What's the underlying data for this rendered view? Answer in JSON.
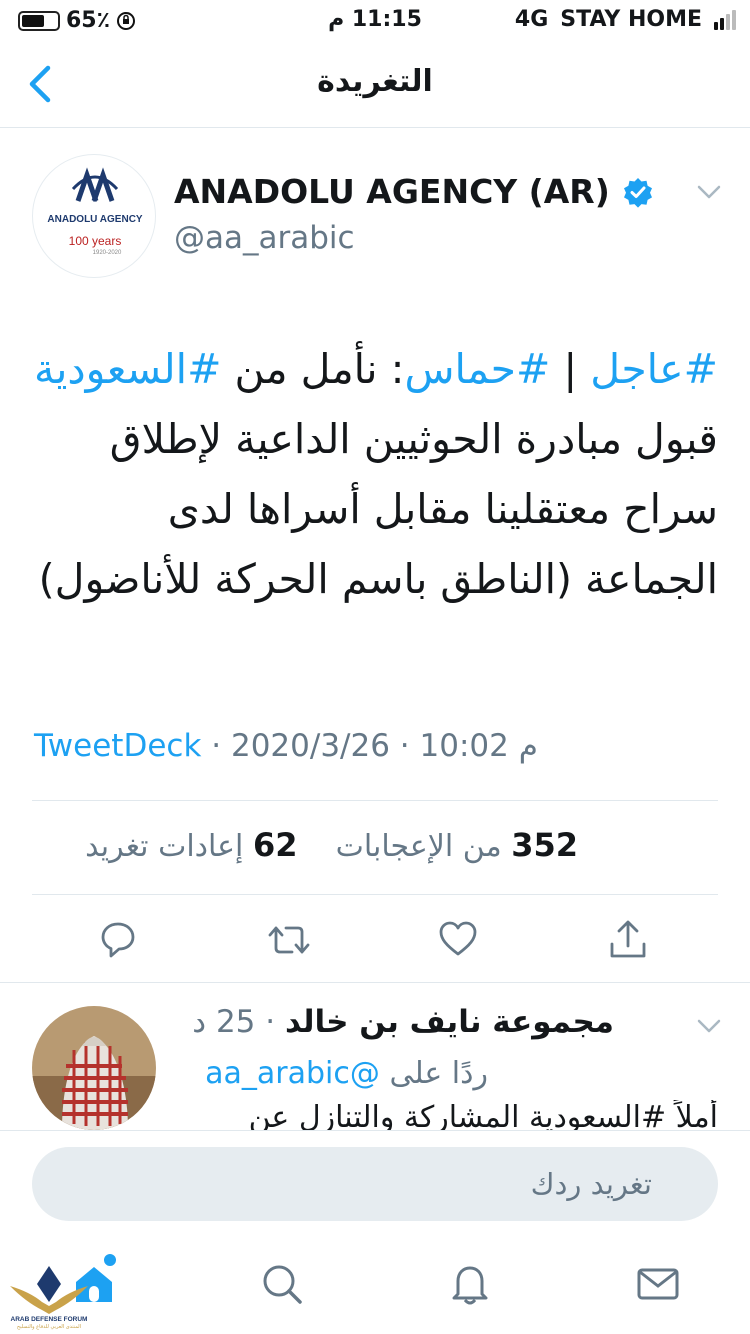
{
  "status_bar": {
    "battery": "65٪",
    "battery_level": 0.65,
    "time": "11:15 م",
    "network": "4G",
    "carrier": "STAY HOME"
  },
  "nav": {
    "title": "التغريدة"
  },
  "tweet": {
    "author_name": "ANADOLU AGENCY (AR)",
    "author_handle": "@aa_arabic",
    "avatar_logo_text": "ANADOLU AGENCY",
    "avatar_years": "100 years",
    "avatar_range": "1920-2020",
    "text_parts": [
      "#عاجل",
      " | ",
      "#حماس",
      ": نأمل من ",
      "#السعودية",
      " قبول مبادرة الحوثيين الداعية لإطلاق سراح معتقلينا مقابل أسراها لدى الجماعة (الناطق باسم الحركة للأناضول)"
    ],
    "time": "10:02 م",
    "date": "2020/3/26",
    "source": "TweetDeck",
    "likes_count": "352",
    "likes_label": "من الإعجابات",
    "retweets_count": "62",
    "retweets_label": "إعادات تغريد"
  },
  "reply": {
    "author_name": "مجموعة نايف بن خالد",
    "time": "25 د",
    "replying_to_label": "ردًا على",
    "replying_to_handle": "@aa_arabic",
    "text_preview": "أملاً #السعودية المشاركة والتنازل عن"
  },
  "compose": {
    "placeholder": "تغريد ردك"
  },
  "watermark": {
    "title": "ARAB DEFENSE FORUM",
    "subtitle": "المنتدى العربي للدفاع والتسليح"
  },
  "colors": {
    "accent": "#1da1f2",
    "text": "#14171a",
    "secondary": "#657786"
  },
  "tabs": [
    {
      "name": "home-icon"
    },
    {
      "name": "search-icon"
    },
    {
      "name": "notifications-icon"
    },
    {
      "name": "messages-icon"
    }
  ]
}
